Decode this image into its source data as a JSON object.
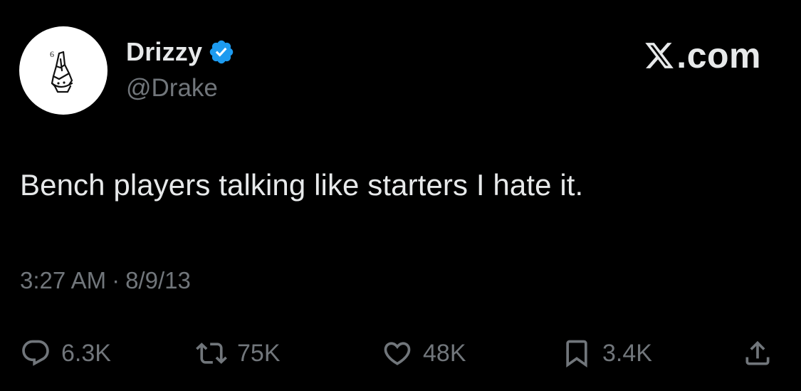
{
  "author": {
    "display_name": "Drizzy",
    "handle": "@Drake",
    "avatar_icon": "praying-hands-owl-icon",
    "avatar_badge_text": "6",
    "verified_icon": "verified-badge-icon",
    "verified_color": "#1d9bf0"
  },
  "brand": {
    "logo_icon": "x-logo-icon",
    "domain": ".com"
  },
  "tweet": {
    "text": "Bench players talking like starters I hate it.",
    "time": "3:27 AM",
    "separator": "·",
    "date": "8/9/13"
  },
  "actions": {
    "reply": {
      "icon": "reply-icon",
      "count": "6.3K"
    },
    "retweet": {
      "icon": "retweet-icon",
      "count": "75K"
    },
    "like": {
      "icon": "heart-icon",
      "count": "48K"
    },
    "bookmark": {
      "icon": "bookmark-icon",
      "count": "3.4K"
    },
    "share": {
      "icon": "share-icon"
    }
  },
  "colors": {
    "background": "#000000",
    "primary_text": "#e7e9ea",
    "secondary_text": "#71767b",
    "accent": "#1d9bf0"
  }
}
